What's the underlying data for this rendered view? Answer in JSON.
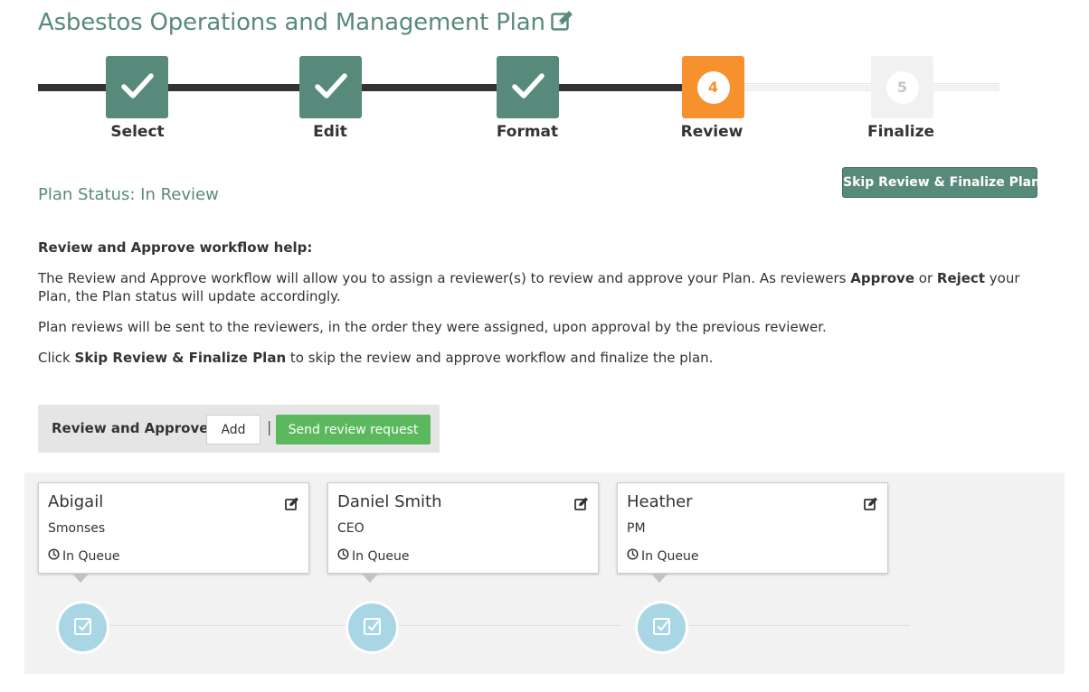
{
  "page": {
    "title": "Asbestos Operations and Management Plan",
    "title_icon": "edit-icon"
  },
  "colors": {
    "brand": "#588a7b",
    "current_step": "#f7912e",
    "future_step": "#f1f1f1",
    "send_button": "#5cb85c",
    "reviewer_node": "#a8d6e5"
  },
  "wizard": {
    "steps": [
      {
        "label": "Select",
        "state": "done",
        "icon": "check-icon"
      },
      {
        "label": "Edit",
        "state": "done",
        "icon": "check-icon"
      },
      {
        "label": "Format",
        "state": "done",
        "icon": "check-icon"
      },
      {
        "label": "Review",
        "state": "current",
        "number": "4"
      },
      {
        "label": "Finalize",
        "state": "future",
        "number": "5"
      }
    ]
  },
  "status": {
    "text": "Plan Status: In Review",
    "skip_button": "Skip Review & Finalize Plan"
  },
  "help": {
    "title": "Review and Approve workflow help:",
    "p1": {
      "a": "The Review and Approve workflow will allow you to assign a reviewer(s) to review and approve your Plan. As reviewers ",
      "b": "Approve",
      "c": " or ",
      "d": "Reject",
      "e": " your Plan, the Plan status will update accordingly."
    },
    "p2": "Plan reviews will be sent to the reviewers, in the order they were assigned, upon approval by the previous reviewer.",
    "p3": {
      "a": "Click ",
      "b": "Skip Review & Finalize Plan",
      "c": " to skip the review and approve workflow and finalize the plan."
    }
  },
  "review_bar": {
    "label": "Review and Approve -",
    "add_button": "Add",
    "separator": "|",
    "send_button": "Send review request"
  },
  "reviewers": [
    {
      "name": "Abigail",
      "role": "Smonses",
      "status": "In Queue",
      "edit_icon": "edit-icon",
      "status_icon": "clock-icon",
      "node_icon": "checkbox-icon"
    },
    {
      "name": "Daniel Smith",
      "role": "CEO",
      "status": "In Queue",
      "edit_icon": "edit-icon",
      "status_icon": "clock-icon",
      "node_icon": "checkbox-icon"
    },
    {
      "name": "Heather",
      "role": "PM",
      "status": "In Queue",
      "edit_icon": "edit-icon",
      "status_icon": "clock-icon",
      "node_icon": "checkbox-icon"
    }
  ]
}
